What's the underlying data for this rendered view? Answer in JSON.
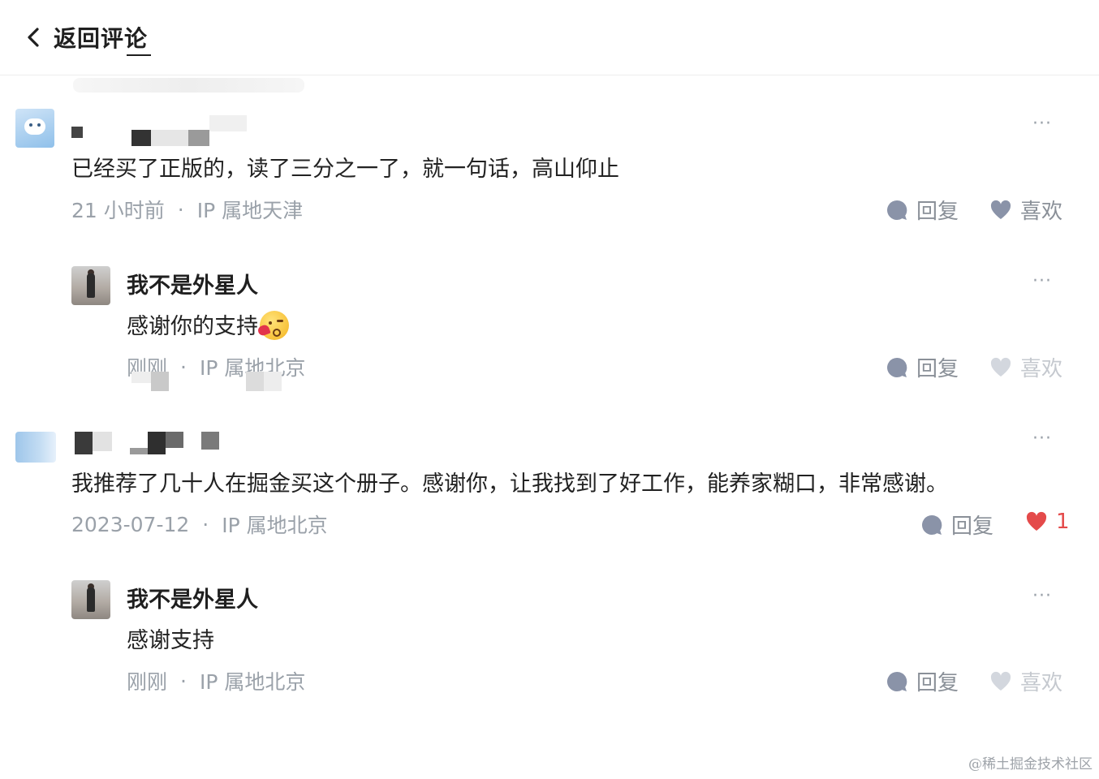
{
  "header": {
    "back_label": "返回评论"
  },
  "comments": [
    {
      "text": "已经买了正版的，读了三分之一了，就一句话，高山仰止",
      "time": "21 小时前",
      "ip": "IP 属地天津",
      "reply_label": "回复",
      "like_label": "喜欢",
      "more": "···",
      "reply": {
        "author": "我不是外星人",
        "text": "感谢你的支持",
        "time": "刚刚",
        "ip": "IP 属地北京",
        "reply_label": "回复",
        "like_label": "喜欢",
        "more": "···"
      }
    },
    {
      "text": "我推荐了几十人在掘金买这个册子。感谢你，让我找到了好工作，能养家糊口，非常感谢。",
      "time": "2023-07-12",
      "ip": "IP 属地北京",
      "reply_label": "回复",
      "like_count": "1",
      "more": "···",
      "reply": {
        "author": "我不是外星人",
        "text": "感谢支持",
        "time": "刚刚",
        "ip": "IP 属地北京",
        "reply_label": "回复",
        "like_label": "喜欢",
        "more": "···"
      }
    }
  ],
  "separator": "·",
  "watermark": "@稀土掘金技术社区",
  "icons": {
    "back": "chevron-left-icon",
    "reply": "comment-bubble-icon",
    "like": "heart-icon",
    "more": "more-dots-icon",
    "emoji": "kiss-heart-emoji"
  },
  "colors": {
    "meta_gray": "#9aa1a9",
    "action_gray": "#8a9098",
    "liked_red": "#e44a4a"
  }
}
